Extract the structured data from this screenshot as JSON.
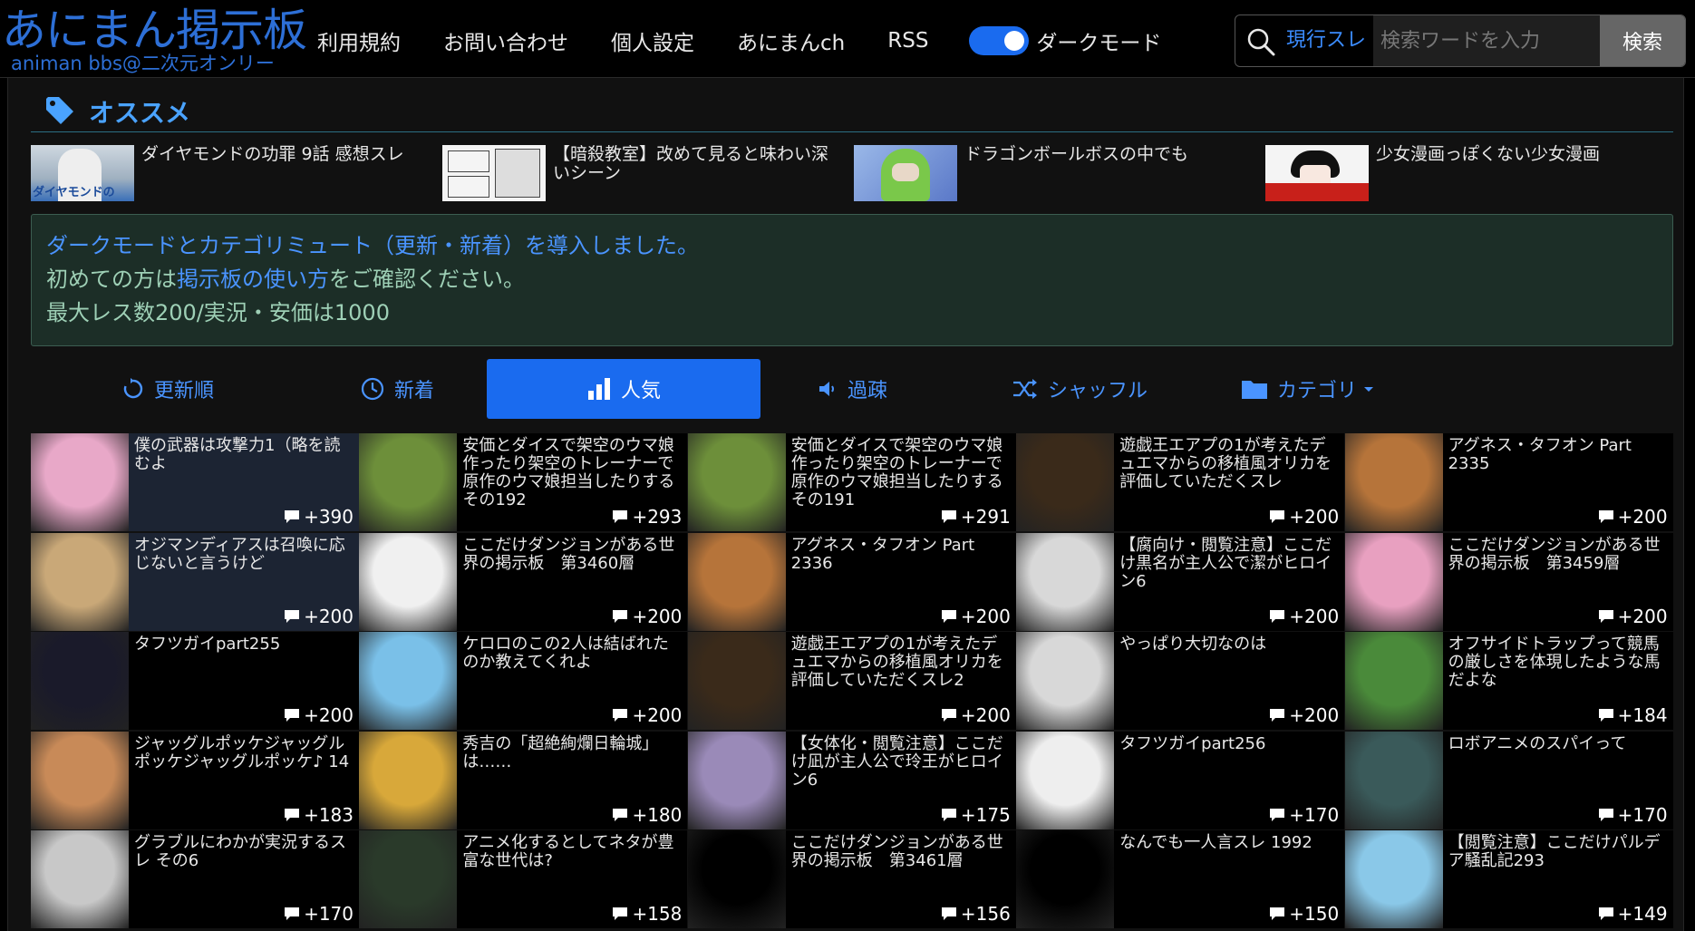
{
  "header": {
    "logo_title": "あにまん掲示板",
    "logo_sub": "animan bbs@二次元オンリー",
    "nav": [
      "利用規約",
      "お問い合わせ",
      "個人設定",
      "あにまんch",
      "RSS"
    ],
    "dark_mode_label": "ダークモード",
    "dark_mode_on": true,
    "search_scope": "現行スレ",
    "search_placeholder": "検索ワードを入力",
    "search_button": "検索"
  },
  "recommend": {
    "title": "オススメ",
    "items": [
      {
        "text": "ダイヤモンドの功罪 9話 感想スレ",
        "thumb_text": "ダイヤモンドの"
      },
      {
        "text": "【暗殺教室】改めて見ると味わい深いシーン"
      },
      {
        "text": "ドラゴンボールボスの中でも"
      },
      {
        "text": "少女漫画っぽくない少女漫画"
      }
    ]
  },
  "notice": {
    "line1": "ダークモードとカテゴリミュート（更新・新着）を導入しました。",
    "line2_pre": "初めての方は",
    "line2_link": "掲示板の使い方",
    "line2_post": "をご確認ください。",
    "line3": "最大レス数200/実況・安価は1000"
  },
  "tabs": [
    "更新順",
    "新着",
    "人気",
    "過疎",
    "シャッフル",
    "カテゴリ"
  ],
  "active_tab": "人気",
  "threads": [
    {
      "title": "僕の武器は攻撃力1（略を読むよ",
      "count": "+390",
      "hl": true,
      "color": "#e8a8c8"
    },
    {
      "title": "安価とダイスで架空のウマ娘作ったり架空のトレーナーで原作のウマ娘担当したりするその192",
      "count": "+293",
      "hl": false,
      "color": "#6d8f3a"
    },
    {
      "title": "安価とダイスで架空のウマ娘作ったり架空のトレーナーで原作のウマ娘担当したりするその191",
      "count": "+291",
      "hl": false,
      "color": "#6d8f3a"
    },
    {
      "title": "遊戯王エアプの1が考えたデュエマからの移植風オリカを評価していただくスレ",
      "count": "+200",
      "hl": false,
      "color": "#3a2a1a"
    },
    {
      "title": "アグネス・タフオン Part 2335",
      "count": "+200",
      "hl": false,
      "color": "#b6743a"
    },
    {
      "title": "オジマンディアスは召喚に応じないと言うけど",
      "count": "+200",
      "hl": true,
      "color": "#c9a878"
    },
    {
      "title": "ここだけダンジョンがある世界の掲示板　第3460層",
      "count": "+200",
      "hl": false,
      "color": "#f0f0f0"
    },
    {
      "title": "アグネス・タフオン Part 2336",
      "count": "+200",
      "hl": false,
      "color": "#b6743a"
    },
    {
      "title": "【腐向け・閲覧注意】ここだけ黒名が主人公で潔がヒロイン6",
      "count": "+200",
      "hl": false,
      "color": "#d8d8d8"
    },
    {
      "title": "ここだけダンジョンがある世界の掲示板　第3459層",
      "count": "+200",
      "hl": false,
      "color": "#e8a0c0"
    },
    {
      "title": "タフツガイpart255",
      "count": "+200",
      "hl": false,
      "color": "#1a1a2a"
    },
    {
      "title": "ケロロのこの2人は結ばれたのか教えてくれよ",
      "count": "+200",
      "hl": false,
      "color": "#7ac0e8"
    },
    {
      "title": "遊戯王エアプの1が考えたデュエマからの移植風オリカを評価していただくスレ2",
      "count": "+200",
      "hl": false,
      "color": "#3a2a1a"
    },
    {
      "title": "やっぱり大切なのは",
      "count": "+200",
      "hl": false,
      "color": "#d8d8d8"
    },
    {
      "title": "オフサイドトラップって競馬の厳しさを体現したような馬だよな",
      "count": "+184",
      "hl": false,
      "color": "#4a8a3a"
    },
    {
      "title": "ジャッグルポッケジャッグルポッケジャッグルポッケ♪ 14",
      "count": "+183",
      "hl": false,
      "color": "#c88a58"
    },
    {
      "title": "秀吉の「超絶絢爛日輪城」は……",
      "count": "+180",
      "hl": false,
      "color": "#d8a83a"
    },
    {
      "title": "【女体化・閲覧注意】ここだけ凪が主人公で玲王がヒロイン6",
      "count": "+175",
      "hl": false,
      "color": "#9a8ab8"
    },
    {
      "title": "タフツガイpart256",
      "count": "+170",
      "hl": false,
      "color": "#eeeeee"
    },
    {
      "title": "ロボアニメのスパイって",
      "count": "+170",
      "hl": false,
      "color": "#3a5a5a"
    },
    {
      "title": "グラブルにわかが実況するスレ その6",
      "count": "+170",
      "hl": false,
      "color": "#c8c8c8"
    },
    {
      "title": "アニメ化するとしてネタが豊富な世代は?",
      "count": "+158",
      "hl": false,
      "color": "#2a3a2a"
    },
    {
      "title": "ここだけダンジョンがある世界の掲示板　第3461層",
      "count": "+156",
      "hl": false,
      "color": "#000000"
    },
    {
      "title": "なんでも一人言スレ 1992",
      "count": "+150",
      "hl": false,
      "color": "#000000"
    },
    {
      "title": "【閲覧注意】ここだけパルデア騒乱記293",
      "count": "+149",
      "hl": false,
      "color": "#8ac8e8"
    }
  ]
}
